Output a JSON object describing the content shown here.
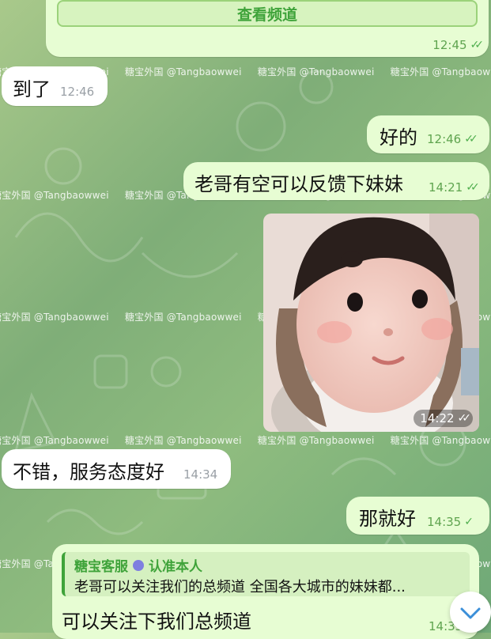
{
  "watermark": "糖宝外国 @Tangbaowwei",
  "messages": {
    "m0_channel_button": "查看频道",
    "m0_time": "12:45",
    "m1_text": "到了",
    "m1_time": "12:46",
    "m2_text": "好的",
    "m2_time": "12:46",
    "m3_text": "老哥有空可以反馈下妹妹",
    "m3_time": "14:21",
    "m4_time": "14:22",
    "m5_text": "不错，服务态度好",
    "m5_time": "14:34",
    "m6_text": "那就好",
    "m6_time": "14:35",
    "m7_reply_author": "糖宝客服",
    "m7_reply_badge": "认准本人",
    "m7_reply_snippet": "老哥可以关注我们的总频道 全国各大城市的妹妹都...",
    "m7_text": "可以关注下我们总频道",
    "m7_time": "14:35"
  },
  "icons": {
    "read_check": "double-check-icon",
    "sent_check": "single-check-icon",
    "scroll_down": "chevron-down-icon",
    "verified": "verified-badge-icon"
  },
  "colors": {
    "outgoing_bubble": "#e7fdd3",
    "incoming_bubble": "#ffffff",
    "accent_green": "#3fa33a"
  }
}
